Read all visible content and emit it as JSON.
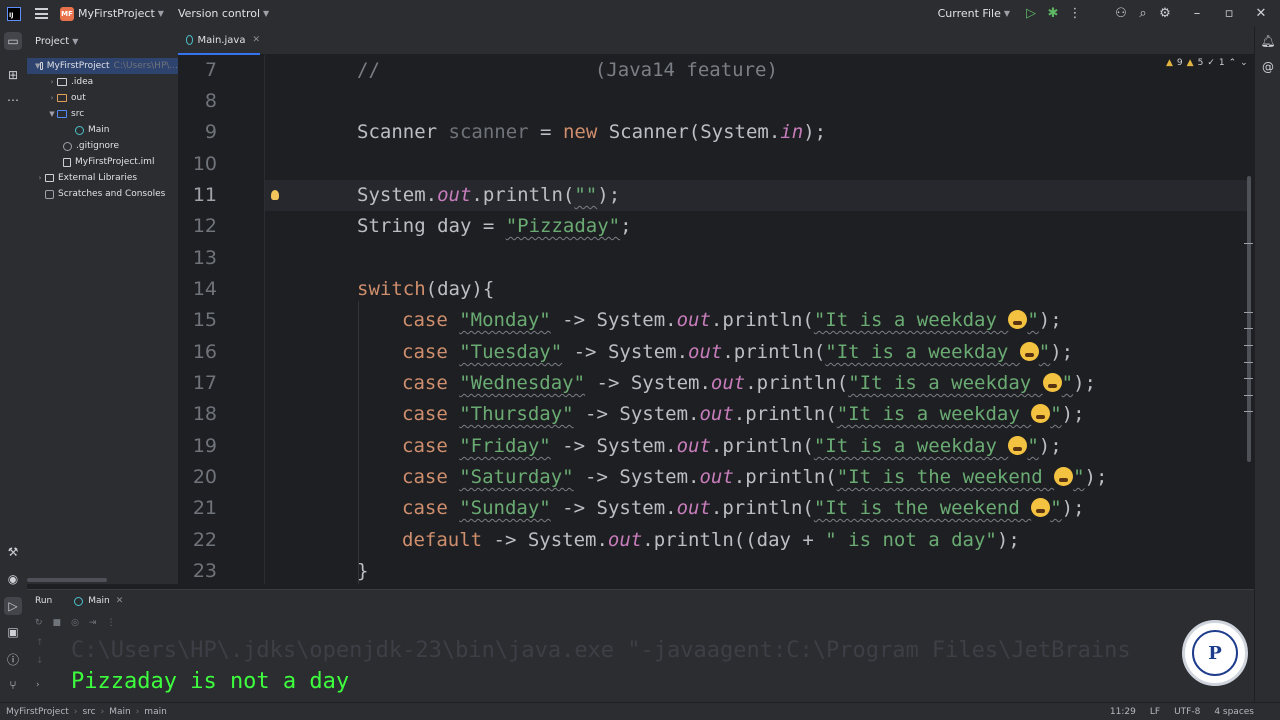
{
  "titlebar": {
    "project_badge": "MF",
    "project_name": "MyFirstProject",
    "vcs_label": "Version control",
    "run_config": "Current File"
  },
  "project_panel": {
    "title": "Project",
    "tree": [
      {
        "label": "MyFirstProject",
        "path": "C:\\Users\\HP\\..."
      },
      {
        "label": ".idea"
      },
      {
        "label": "out"
      },
      {
        "label": "src"
      },
      {
        "label": "Main"
      },
      {
        "label": ".gitignore"
      },
      {
        "label": "MyFirstProject.iml"
      },
      {
        "label": "External Libraries"
      },
      {
        "label": "Scratches and Consoles"
      }
    ]
  },
  "editor": {
    "tab_label": "Main.java",
    "inspection": {
      "warnings": "9",
      "weak_warnings": "5",
      "typos": "1"
    },
    "line_numbers": [
      "7",
      "8",
      "9",
      "10",
      "11",
      "12",
      "13",
      "14",
      "15",
      "16",
      "17",
      "18",
      "19",
      "20",
      "21",
      "22",
      "23"
    ],
    "code": {
      "l7_comment": "//",
      "l7_feature": "(Java14 feature)",
      "l9_type": "Scanner",
      "l9_var": "scanner",
      "l9_eq": " = ",
      "l9_new": "new",
      "l9_rest1": " Scanner(System.",
      "l9_in": "in",
      "l9_rest2": ");",
      "sys": "System.",
      "out": "out",
      "println_open": ".println(",
      "empty_str": "\"\"",
      "close": ");",
      "l12_decl": "String day = ",
      "l12_val": "\"Pizzaday\"",
      "l12_end": ";",
      "l14_switch": "switch",
      "l14_rest": "(day){",
      "case": "case",
      "arrow": " -> ",
      "weekday_str": "\"It is a weekday ",
      "weekend_str": "\"It is the weekend ",
      "quote": "\"",
      "days": [
        "\"Monday\"",
        "\"Tuesday\"",
        "\"Wednesday\"",
        "\"Thursday\"",
        "\"Friday\"",
        "\"Saturday\"",
        "\"Sunday\""
      ],
      "default": "default",
      "l22_rest1": "(day + ",
      "l22_str": "\" is not a day\"",
      "l22_rest2": ");",
      "l23_brace": "}"
    }
  },
  "run": {
    "title": "Run",
    "tab_label": "Main",
    "command": "C:\\Users\\HP\\.jdks\\openjdk-23\\bin\\java.exe \"-javaagent:C:\\Program Files\\JetBrains",
    "output": "Pizzaday is not a day"
  },
  "statusbar": {
    "crumbs": [
      "MyFirstProject",
      "src",
      "Main",
      "main"
    ],
    "position": "11:29",
    "line_sep": "LF",
    "encoding": "UTF-8",
    "indent": "4 spaces"
  }
}
